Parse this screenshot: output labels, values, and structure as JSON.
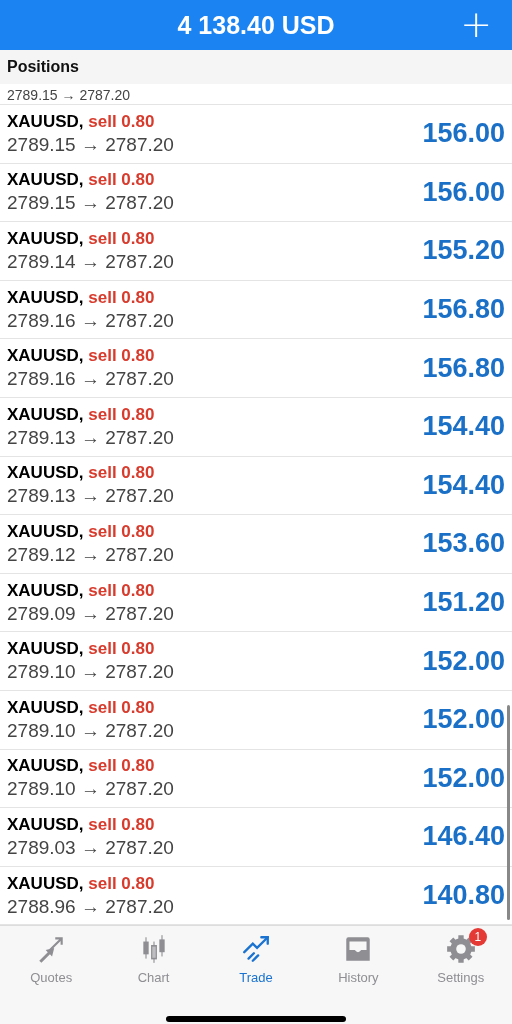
{
  "header": {
    "title": "4 138.40 USD",
    "add_button": "+"
  },
  "section": {
    "title": "Positions"
  },
  "cut_row": {
    "prices": "2789.15 → 2787.20"
  },
  "positions": [
    {
      "symbol": "XAUUSD,",
      "side": "sell 0.80",
      "prices": "2789.15 → 2787.20",
      "profit": "156.00"
    },
    {
      "symbol": "XAUUSD,",
      "side": "sell 0.80",
      "prices": "2789.15 → 2787.20",
      "profit": "156.00"
    },
    {
      "symbol": "XAUUSD,",
      "side": "sell 0.80",
      "prices": "2789.14 → 2787.20",
      "profit": "155.20"
    },
    {
      "symbol": "XAUUSD,",
      "side": "sell 0.80",
      "prices": "2789.16 → 2787.20",
      "profit": "156.80"
    },
    {
      "symbol": "XAUUSD,",
      "side": "sell 0.80",
      "prices": "2789.16 → 2787.20",
      "profit": "156.80"
    },
    {
      "symbol": "XAUUSD,",
      "side": "sell 0.80",
      "prices": "2789.13 → 2787.20",
      "profit": "154.40"
    },
    {
      "symbol": "XAUUSD,",
      "side": "sell 0.80",
      "prices": "2789.13 → 2787.20",
      "profit": "154.40"
    },
    {
      "symbol": "XAUUSD,",
      "side": "sell 0.80",
      "prices": "2789.12 → 2787.20",
      "profit": "153.60"
    },
    {
      "symbol": "XAUUSD,",
      "side": "sell 0.80",
      "prices": "2789.09 → 2787.20",
      "profit": "151.20"
    },
    {
      "symbol": "XAUUSD,",
      "side": "sell 0.80",
      "prices": "2789.10 → 2787.20",
      "profit": "152.00"
    },
    {
      "symbol": "XAUUSD,",
      "side": "sell 0.80",
      "prices": "2789.10 → 2787.20",
      "profit": "152.00"
    },
    {
      "symbol": "XAUUSD,",
      "side": "sell 0.80",
      "prices": "2789.10 → 2787.20",
      "profit": "152.00"
    },
    {
      "symbol": "XAUUSD,",
      "side": "sell 0.80",
      "prices": "2789.03 → 2787.20",
      "profit": "146.40"
    },
    {
      "symbol": "XAUUSD,",
      "side": "sell 0.80",
      "prices": "2788.96 → 2787.20",
      "profit": "140.80"
    }
  ],
  "tabs": [
    {
      "kind": "quotes",
      "label": "Quotes",
      "selected": false
    },
    {
      "kind": "chart",
      "label": "Chart",
      "selected": false
    },
    {
      "kind": "trade",
      "label": "Trade",
      "selected": true
    },
    {
      "kind": "history",
      "label": "History",
      "selected": false
    },
    {
      "kind": "settings",
      "label": "Settings",
      "selected": false,
      "badge": "1"
    }
  ]
}
